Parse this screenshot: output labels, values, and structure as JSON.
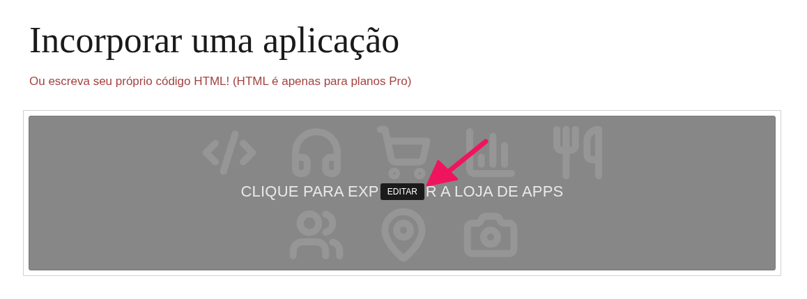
{
  "title": "Incorporar uma aplicação",
  "subtitle": "Ou escreva seu próprio código HTML! (HTML é apenas para planos Pro)",
  "app_store_panel": {
    "text_before": "CLIQUE PARA EXP",
    "edit_badge": "EDITAR",
    "text_after": "R A LOJA DE APPS"
  }
}
